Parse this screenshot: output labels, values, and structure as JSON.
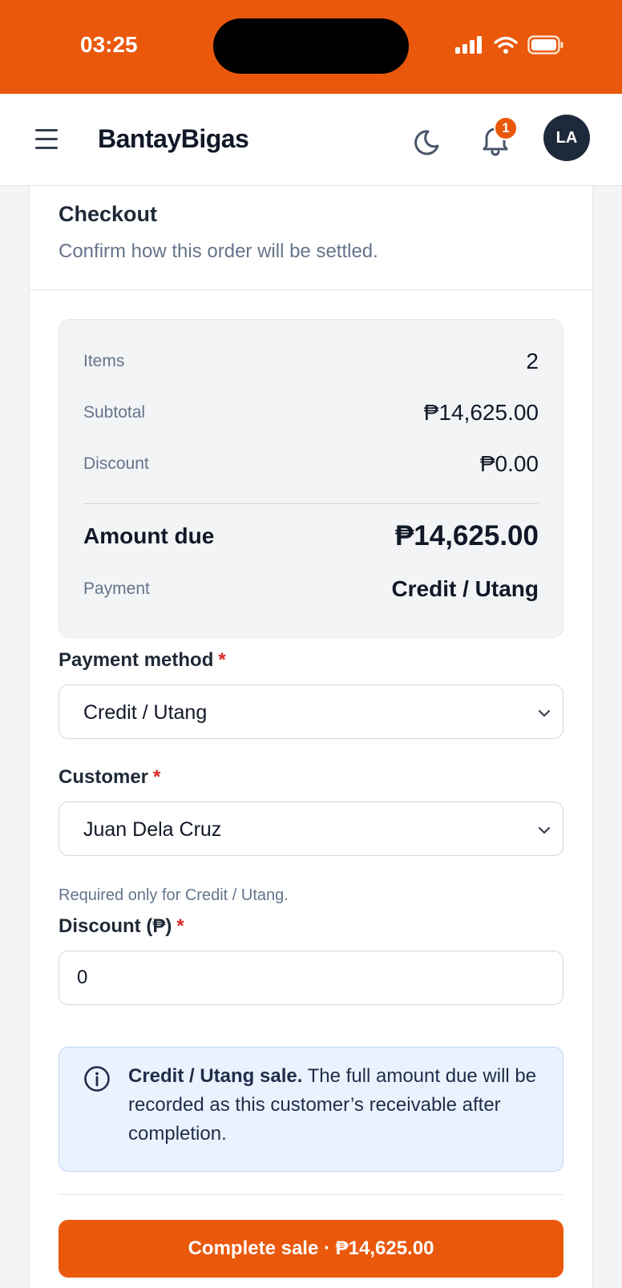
{
  "status_bar": {
    "time": "03:25",
    "signal_icon": "signal-icon",
    "wifi_icon": "wifi-icon",
    "battery_icon": "battery-icon"
  },
  "header": {
    "menu_icon": "menu-icon",
    "brand": "BantayBigas",
    "theme_icon": "moon-icon",
    "bell_icon": "bell-icon",
    "notification_count": "1",
    "avatar_initials": "LA"
  },
  "checkout": {
    "title": "Checkout",
    "subtitle": "Confirm how this order will be settled.",
    "summary": {
      "items_label": "Items",
      "items_value": "2",
      "subtotal_label": "Subtotal",
      "subtotal_value": "₱14,625.00",
      "discount_label": "Discount",
      "discount_value": "₱0.00",
      "amount_due_label": "Amount due",
      "amount_due_value": "₱14,625.00",
      "payment_label": "Payment",
      "payment_value": "Credit / Utang"
    },
    "payment_method": {
      "label": "Payment method",
      "required_mark": "*",
      "selected": "Credit / Utang"
    },
    "customer": {
      "label": "Customer",
      "required_mark": "*",
      "selected": "Juan Dela Cruz",
      "hint": "Required only for Credit / Utang."
    },
    "discount": {
      "label": "Discount (₱)",
      "required_mark": "*",
      "value": "0"
    },
    "notice": {
      "icon": "info-icon",
      "bold": "Credit / Utang sale.",
      "text": " The full amount due will be recorded as this customer’s receivable after completion."
    },
    "complete_button": "Complete sale · ₱14,625.00"
  },
  "colors": {
    "accent": "#ea580c",
    "avatar_bg": "#1e293b",
    "info_bg": "#eaf2fe",
    "required": "#dc2626"
  }
}
